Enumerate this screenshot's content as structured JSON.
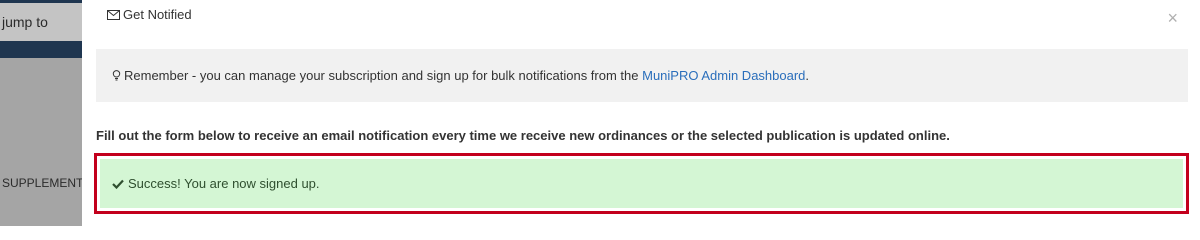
{
  "background": {
    "jump_text": "jump to",
    "supplement_text": "SUPPLEMENT"
  },
  "modal": {
    "title": "Get Notified",
    "close_label": "×",
    "info": {
      "text_before": "Remember - you can manage your subscription and sign up for bulk notifications from the ",
      "link_text": "MuniPRO Admin Dashboard",
      "text_after": "."
    },
    "instructions": "Fill out the form below to receive an email notification every time we receive new ordinances or the selected publication is updated online.",
    "success_message": "Success! You are now signed up."
  },
  "colors": {
    "navy": "#1f3650",
    "link": "#2a6ebb",
    "success_bg": "#d4f6d4",
    "highlight_border": "#c3001d"
  },
  "icons": {
    "title_icon": "envelope-icon",
    "info_icon": "lightbulb-icon",
    "success_icon": "check-icon"
  }
}
